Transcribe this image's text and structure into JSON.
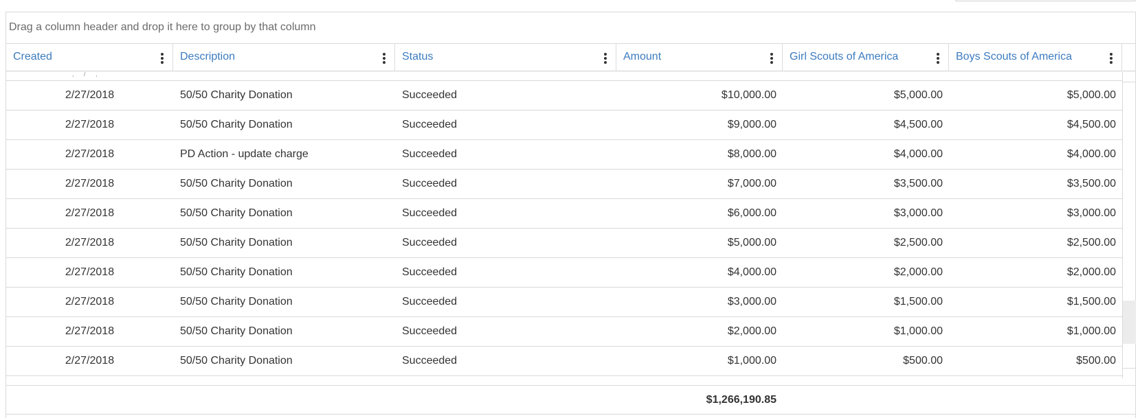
{
  "group_panel": {
    "hint": "Drag a column header and drop it here to group by that column"
  },
  "columns": [
    {
      "label": "Created"
    },
    {
      "label": "Description"
    },
    {
      "label": "Status"
    },
    {
      "label": "Amount"
    },
    {
      "label": "Girl Scouts of America"
    },
    {
      "label": "Boys Scouts of America"
    }
  ],
  "rows": [
    {
      "created": "2/27/2018",
      "description": "50/50 Charity Donation",
      "status": "Succeeded",
      "amount": "$10,000.00",
      "girl": "$5,000.00",
      "boy": "$5,000.00"
    },
    {
      "created": "2/27/2018",
      "description": "50/50 Charity Donation",
      "status": "Succeeded",
      "amount": "$9,000.00",
      "girl": "$4,500.00",
      "boy": "$4,500.00"
    },
    {
      "created": "2/27/2018",
      "description": "PD Action - update charge",
      "status": "Succeeded",
      "amount": "$8,000.00",
      "girl": "$4,000.00",
      "boy": "$4,000.00"
    },
    {
      "created": "2/27/2018",
      "description": "50/50 Charity Donation",
      "status": "Succeeded",
      "amount": "$7,000.00",
      "girl": "$3,500.00",
      "boy": "$3,500.00"
    },
    {
      "created": "2/27/2018",
      "description": "50/50 Charity Donation",
      "status": "Succeeded",
      "amount": "$6,000.00",
      "girl": "$3,000.00",
      "boy": "$3,000.00"
    },
    {
      "created": "2/27/2018",
      "description": "50/50 Charity Donation",
      "status": "Succeeded",
      "amount": "$5,000.00",
      "girl": "$2,500.00",
      "boy": "$2,500.00"
    },
    {
      "created": "2/27/2018",
      "description": "50/50 Charity Donation",
      "status": "Succeeded",
      "amount": "$4,000.00",
      "girl": "$2,000.00",
      "boy": "$2,000.00"
    },
    {
      "created": "2/27/2018",
      "description": "50/50 Charity Donation",
      "status": "Succeeded",
      "amount": "$3,000.00",
      "girl": "$1,500.00",
      "boy": "$1,500.00"
    },
    {
      "created": "2/27/2018",
      "description": "50/50 Charity Donation",
      "status": "Succeeded",
      "amount": "$2,000.00",
      "girl": "$1,000.00",
      "boy": "$1,000.00"
    },
    {
      "created": "2/27/2018",
      "description": "50/50 Charity Donation",
      "status": "Succeeded",
      "amount": "$1,000.00",
      "girl": "$500.00",
      "boy": "$500.00"
    }
  ],
  "footer": {
    "amount_total": "$1,266,190.85"
  }
}
